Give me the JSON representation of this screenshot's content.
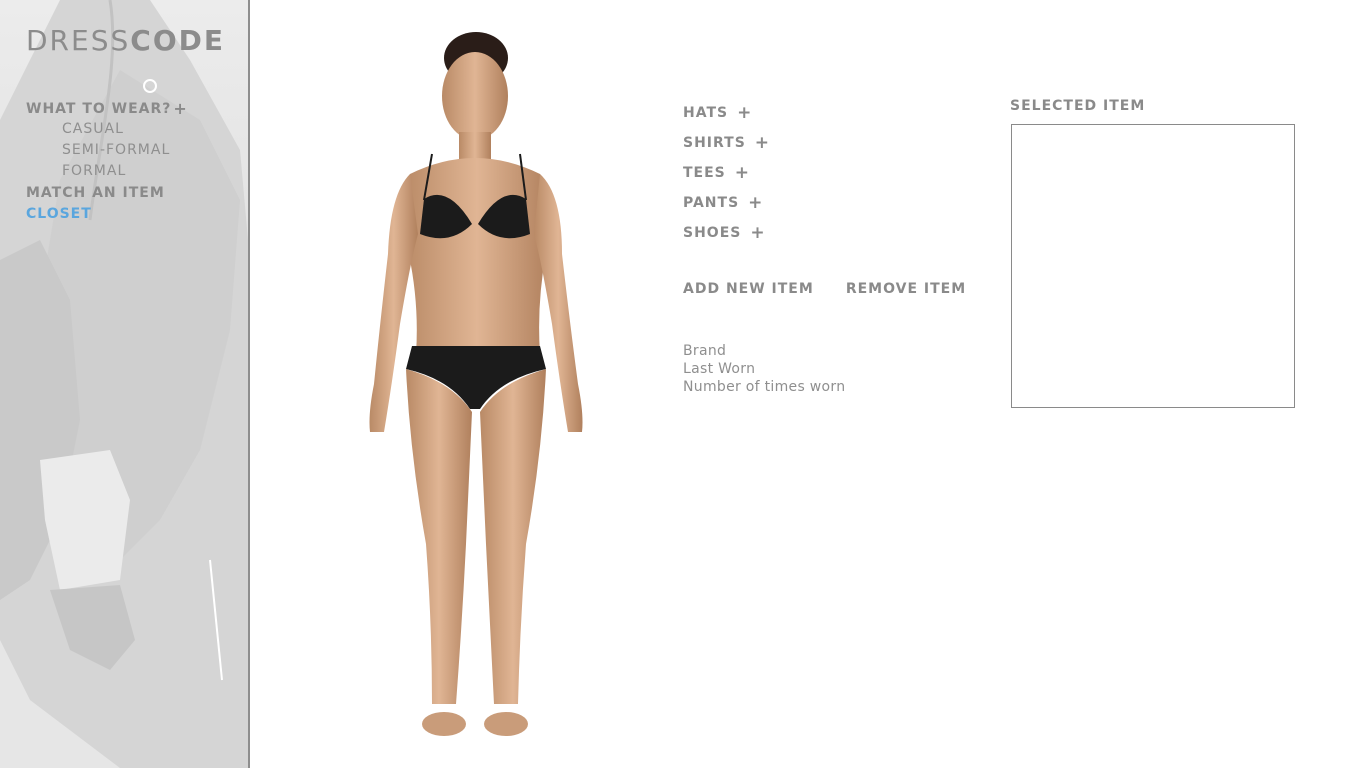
{
  "app": {
    "logo_light": "DRESS",
    "logo_bold": "CODE"
  },
  "sidebar": {
    "nav": [
      {
        "label": "WHAT TO WEAR?",
        "has_plus": true
      },
      {
        "label": "MATCH AN ITEM"
      },
      {
        "label": "CLOSET",
        "active": true
      }
    ],
    "sub_items": [
      "CASUAL",
      "SEMI-FORMAL",
      "FORMAL"
    ],
    "plus_symbol": "+"
  },
  "categories": [
    {
      "label": "HATS",
      "icon": "plus-icon"
    },
    {
      "label": "SHIRTS",
      "icon": "plus-icon"
    },
    {
      "label": "TEES",
      "icon": "plus-icon"
    },
    {
      "label": "PANTS",
      "icon": "plus-icon"
    },
    {
      "label": "SHOES",
      "icon": "plus-icon"
    }
  ],
  "plus_symbol": "+",
  "actions": {
    "add_label": "ADD NEW ITEM",
    "remove_label": "REMOVE ITEM"
  },
  "details": {
    "brand": "Brand",
    "last_worn": "Last Worn",
    "times_worn": "Number of times worn"
  },
  "selected": {
    "label": "SELECTED ITEM"
  },
  "colors": {
    "active_nav": "#5aa6de",
    "text_gray": "#8a8a8a",
    "sidebar_border": "#8e8e8e"
  }
}
